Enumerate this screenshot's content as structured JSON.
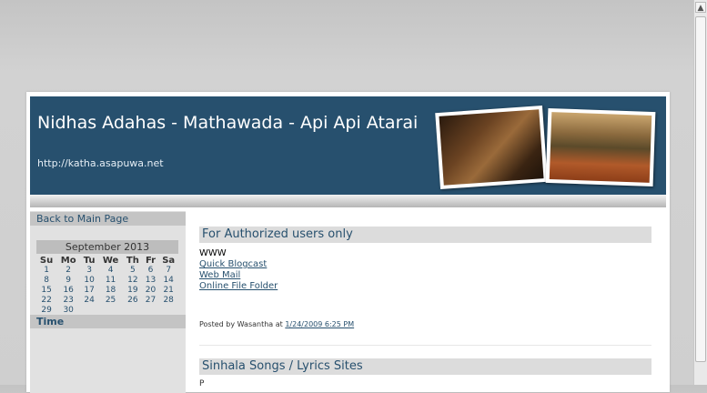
{
  "header": {
    "title": "Nidhas Adahas - Mathawada - Api Api Atarai",
    "url": "http://katha.asapuwa.net"
  },
  "sidebar": {
    "back_link": "Back to Main Page",
    "calendar": {
      "month": "September 2013",
      "days": [
        "Su",
        "Mo",
        "Tu",
        "We",
        "Th",
        "Fr",
        "Sa"
      ],
      "weeks": [
        [
          "1",
          "2",
          "3",
          "4",
          "5",
          "6",
          "7"
        ],
        [
          "8",
          "9",
          "10",
          "11",
          "12",
          "13",
          "14"
        ],
        [
          "15",
          "16",
          "17",
          "18",
          "19",
          "20",
          "21"
        ],
        [
          "22",
          "23",
          "24",
          "25",
          "26",
          "27",
          "28"
        ],
        [
          "29",
          "30",
          "",
          "",
          "",
          "",
          ""
        ]
      ]
    },
    "time_heading": "Time"
  },
  "posts": [
    {
      "title": "For Authorized users only",
      "body_header": "WWW",
      "links": [
        "Quick Blogcast",
        "Web Mail",
        "Online File Folder "
      ],
      "posted_by_prefix": "Posted by Wasantha at",
      "timestamp": "1/24/2009 6:25 PM"
    },
    {
      "title": "Sinhala Songs / Lyrics Sites",
      "body_start": "P"
    }
  ],
  "colors": {
    "header_bg": "#27506e",
    "accent_link": "#27506e",
    "sidebar_bg": "#e1e1e1",
    "post_title_bg": "#dcdcdc"
  }
}
